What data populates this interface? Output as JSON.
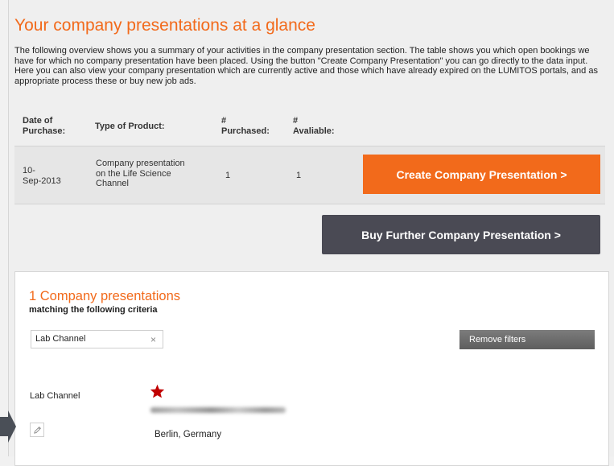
{
  "header": {
    "title": "Your company presentations at a glance",
    "intro": "The following overview shows you a summary of your activities in the company presentation section. The table shows you which open bookings we have for which no company presentation have been placed. Using the button \"Create Company Presentation\" you can go directly to the data input. Here you can also view your company presentation which are currently active and those which have already expired on the LUMITOS portals, and as appropriate process these or buy new job ads."
  },
  "table": {
    "columns": [
      {
        "line1": "Date of",
        "line2": "Purchase:"
      },
      {
        "line1": "Type of Product:",
        "line2": ""
      },
      {
        "line1": "#",
        "line2": "Purchased:"
      },
      {
        "line1": "#",
        "line2": "Avaliable:"
      }
    ],
    "rows": [
      {
        "date_line1": "10-",
        "date_line2": "Sep-2013",
        "product_line1": "Company presentation",
        "product_line2": "on the Life Science",
        "product_line3": "Channel",
        "purchased": "1",
        "available": "1"
      }
    ]
  },
  "buttons": {
    "create": "Create Company Presentation >",
    "buy": "Buy Further Company Presentation >"
  },
  "results": {
    "title": "1 Company presentations",
    "subtitle": "matching the following criteria",
    "filter_label": "Lab Channel",
    "filter_remove_glyph": "×",
    "remove_filters": "Remove filters",
    "items": [
      {
        "channel": "Lab Channel",
        "location": "Berlin, Germany"
      }
    ]
  },
  "colors": {
    "accent": "#f26a1b",
    "dark_button": "#4a4a54",
    "star": "#c00000"
  },
  "icons": [
    "star-icon",
    "pencil-icon",
    "close-icon",
    "arrow-pointer-icon"
  ]
}
